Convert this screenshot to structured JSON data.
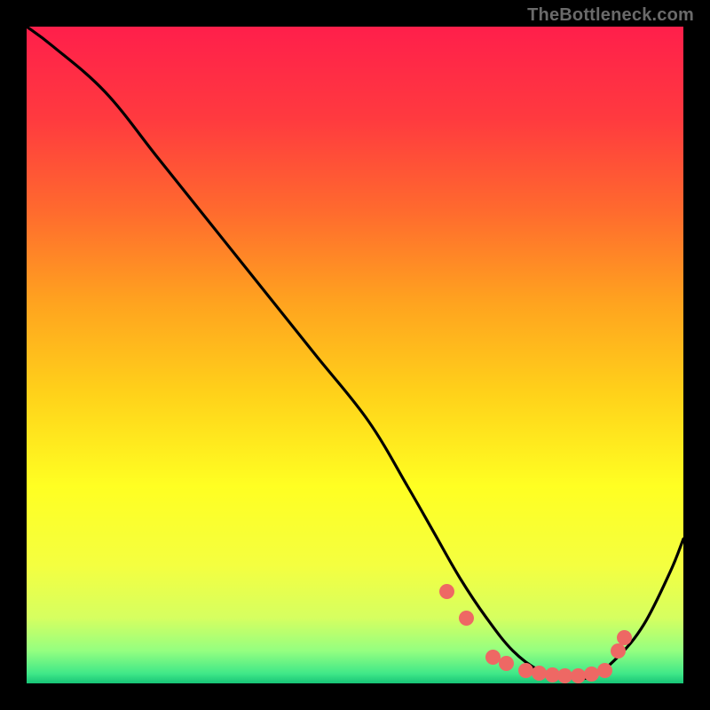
{
  "attribution": "TheBottleneck.com",
  "chart_data": {
    "type": "line",
    "title": "",
    "xlabel": "",
    "ylabel": "",
    "xlim": [
      0,
      100
    ],
    "ylim": [
      0,
      100
    ],
    "curve": {
      "x": [
        0,
        4,
        12,
        20,
        28,
        36,
        44,
        52,
        58,
        62,
        66,
        70,
        74,
        78,
        82,
        86,
        90,
        94,
        98,
        100
      ],
      "y": [
        100,
        97,
        90,
        80,
        70,
        60,
        50,
        40,
        30,
        23,
        16,
        10,
        5,
        2,
        1,
        1,
        4,
        9,
        17,
        22
      ]
    },
    "markers": {
      "x": [
        64,
        67,
        71,
        73,
        76,
        78,
        80,
        82,
        84,
        86,
        88,
        90,
        91
      ],
      "y": [
        14,
        10,
        4,
        3,
        2,
        1.5,
        1.3,
        1.2,
        1.2,
        1.4,
        2,
        5,
        7
      ]
    },
    "gradient_stops": [
      {
        "offset": 0.0,
        "color": "#ff1f4b"
      },
      {
        "offset": 0.14,
        "color": "#ff3a3f"
      },
      {
        "offset": 0.28,
        "color": "#ff6a2e"
      },
      {
        "offset": 0.42,
        "color": "#ffa31f"
      },
      {
        "offset": 0.56,
        "color": "#ffd21a"
      },
      {
        "offset": 0.7,
        "color": "#ffff22"
      },
      {
        "offset": 0.82,
        "color": "#f4ff40"
      },
      {
        "offset": 0.9,
        "color": "#d6ff60"
      },
      {
        "offset": 0.95,
        "color": "#95ff80"
      },
      {
        "offset": 0.985,
        "color": "#40e888"
      },
      {
        "offset": 1.0,
        "color": "#17c477"
      }
    ]
  }
}
